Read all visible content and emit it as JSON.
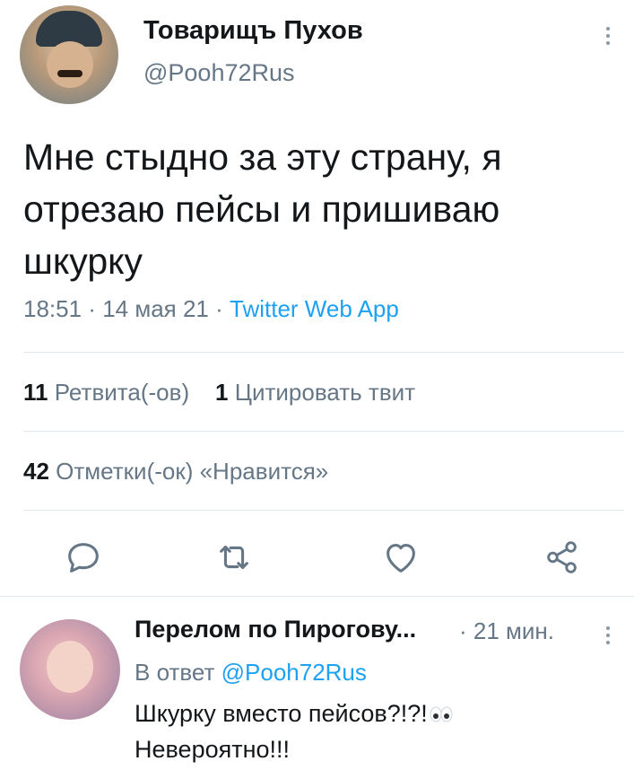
{
  "tweet": {
    "author_name": "Товарищъ Пухов",
    "author_handle": "@Pooh72Rus",
    "text": "Мне стыдно за эту страну, я отрезаю пейсы и пришиваю шкурку",
    "time": "18:51",
    "date": "14 мая 21",
    "source": "Twitter Web App",
    "separator": " · "
  },
  "stats": {
    "retweets_count": "11",
    "retweets_label": "Ретвита(-ов)",
    "quotes_count": "1",
    "quotes_label": "Цитировать твит",
    "likes_count": "42",
    "likes_label": "Отметки(-ок) «Нравится»"
  },
  "actions": [
    "reply-icon",
    "retweet-icon",
    "like-icon",
    "share-icon"
  ],
  "reply": {
    "author_name": "Перелом по Пирогову...",
    "time": "21 мин.",
    "reply_to_prefix": "В ответ",
    "reply_to_handle": "@Pooh72Rus",
    "text_line1": "Шкурку вместо пейсов?!?!",
    "text_line2": "Невероятно!!!"
  },
  "colors": {
    "text": "#14171a",
    "secondary": "#657786",
    "link": "#1da1f2",
    "divider": "#e1e8ed",
    "icon": "#657786"
  }
}
